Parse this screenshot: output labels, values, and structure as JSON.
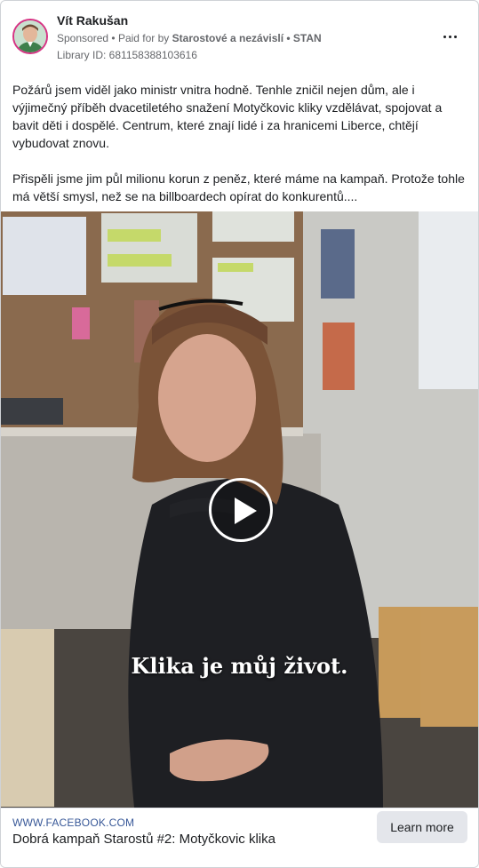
{
  "post": {
    "author": "Vít Rakušan",
    "sponsored": "Sponsored",
    "paid_for_prefix": "Paid for by",
    "paid_for_by": "Starostové a nezávislí • STAN",
    "library_id": "Library ID: 681158388103616",
    "paragraph_1": "Požárů jsem viděl jako ministr vnitra hodně. Tenhle zničil nejen dům, ale i výjimečný příběh dvacetiletého snažení Motyčkovic kliky vzdělávat, spojovat a bavit děti i dospělé. Centrum, které znají lidé i za hranicemi Liberce, chtějí vybudovat znovu.",
    "paragraph_2": "Přispěli jsme jim půl milionu korun z peněz, které máme na kampaň. Protože tohle má větší smysl, než se na billboardech opírat do konkurentů...."
  },
  "video": {
    "subtitle": "Klika je můj život."
  },
  "link": {
    "domain": "WWW.FACEBOOK.COM",
    "title": "Dobrá kampaň Starostů #2: Motyčkovic klika",
    "cta_label": "Learn more"
  },
  "icons": {
    "more": "more-options-icon",
    "play": "play-icon"
  },
  "colors": {
    "avatar_ring": "#d63384",
    "link_domain": "#385898",
    "secondary_text": "#65676b",
    "cta_background": "#e4e6eb"
  }
}
